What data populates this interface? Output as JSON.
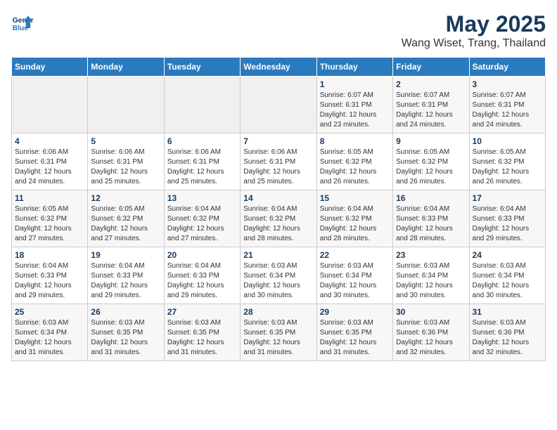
{
  "logo": {
    "line1": "General",
    "line2": "Blue"
  },
  "title": "May 2025",
  "subtitle": "Wang Wiset, Trang, Thailand",
  "days_of_week": [
    "Sunday",
    "Monday",
    "Tuesday",
    "Wednesday",
    "Thursday",
    "Friday",
    "Saturday"
  ],
  "weeks": [
    [
      {
        "day": "",
        "info": ""
      },
      {
        "day": "",
        "info": ""
      },
      {
        "day": "",
        "info": ""
      },
      {
        "day": "",
        "info": ""
      },
      {
        "day": "1",
        "info": "Sunrise: 6:07 AM\nSunset: 6:31 PM\nDaylight: 12 hours\nand 23 minutes."
      },
      {
        "day": "2",
        "info": "Sunrise: 6:07 AM\nSunset: 6:31 PM\nDaylight: 12 hours\nand 24 minutes."
      },
      {
        "day": "3",
        "info": "Sunrise: 6:07 AM\nSunset: 6:31 PM\nDaylight: 12 hours\nand 24 minutes."
      }
    ],
    [
      {
        "day": "4",
        "info": "Sunrise: 6:06 AM\nSunset: 6:31 PM\nDaylight: 12 hours\nand 24 minutes."
      },
      {
        "day": "5",
        "info": "Sunrise: 6:06 AM\nSunset: 6:31 PM\nDaylight: 12 hours\nand 25 minutes."
      },
      {
        "day": "6",
        "info": "Sunrise: 6:06 AM\nSunset: 6:31 PM\nDaylight: 12 hours\nand 25 minutes."
      },
      {
        "day": "7",
        "info": "Sunrise: 6:06 AM\nSunset: 6:31 PM\nDaylight: 12 hours\nand 25 minutes."
      },
      {
        "day": "8",
        "info": "Sunrise: 6:05 AM\nSunset: 6:32 PM\nDaylight: 12 hours\nand 26 minutes."
      },
      {
        "day": "9",
        "info": "Sunrise: 6:05 AM\nSunset: 6:32 PM\nDaylight: 12 hours\nand 26 minutes."
      },
      {
        "day": "10",
        "info": "Sunrise: 6:05 AM\nSunset: 6:32 PM\nDaylight: 12 hours\nand 26 minutes."
      }
    ],
    [
      {
        "day": "11",
        "info": "Sunrise: 6:05 AM\nSunset: 6:32 PM\nDaylight: 12 hours\nand 27 minutes."
      },
      {
        "day": "12",
        "info": "Sunrise: 6:05 AM\nSunset: 6:32 PM\nDaylight: 12 hours\nand 27 minutes."
      },
      {
        "day": "13",
        "info": "Sunrise: 6:04 AM\nSunset: 6:32 PM\nDaylight: 12 hours\nand 27 minutes."
      },
      {
        "day": "14",
        "info": "Sunrise: 6:04 AM\nSunset: 6:32 PM\nDaylight: 12 hours\nand 28 minutes."
      },
      {
        "day": "15",
        "info": "Sunrise: 6:04 AM\nSunset: 6:32 PM\nDaylight: 12 hours\nand 28 minutes."
      },
      {
        "day": "16",
        "info": "Sunrise: 6:04 AM\nSunset: 6:33 PM\nDaylight: 12 hours\nand 28 minutes."
      },
      {
        "day": "17",
        "info": "Sunrise: 6:04 AM\nSunset: 6:33 PM\nDaylight: 12 hours\nand 29 minutes."
      }
    ],
    [
      {
        "day": "18",
        "info": "Sunrise: 6:04 AM\nSunset: 6:33 PM\nDaylight: 12 hours\nand 29 minutes."
      },
      {
        "day": "19",
        "info": "Sunrise: 6:04 AM\nSunset: 6:33 PM\nDaylight: 12 hours\nand 29 minutes."
      },
      {
        "day": "20",
        "info": "Sunrise: 6:04 AM\nSunset: 6:33 PM\nDaylight: 12 hours\nand 29 minutes."
      },
      {
        "day": "21",
        "info": "Sunrise: 6:03 AM\nSunset: 6:34 PM\nDaylight: 12 hours\nand 30 minutes."
      },
      {
        "day": "22",
        "info": "Sunrise: 6:03 AM\nSunset: 6:34 PM\nDaylight: 12 hours\nand 30 minutes."
      },
      {
        "day": "23",
        "info": "Sunrise: 6:03 AM\nSunset: 6:34 PM\nDaylight: 12 hours\nand 30 minutes."
      },
      {
        "day": "24",
        "info": "Sunrise: 6:03 AM\nSunset: 6:34 PM\nDaylight: 12 hours\nand 30 minutes."
      }
    ],
    [
      {
        "day": "25",
        "info": "Sunrise: 6:03 AM\nSunset: 6:34 PM\nDaylight: 12 hours\nand 31 minutes."
      },
      {
        "day": "26",
        "info": "Sunrise: 6:03 AM\nSunset: 6:35 PM\nDaylight: 12 hours\nand 31 minutes."
      },
      {
        "day": "27",
        "info": "Sunrise: 6:03 AM\nSunset: 6:35 PM\nDaylight: 12 hours\nand 31 minutes."
      },
      {
        "day": "28",
        "info": "Sunrise: 6:03 AM\nSunset: 6:35 PM\nDaylight: 12 hours\nand 31 minutes."
      },
      {
        "day": "29",
        "info": "Sunrise: 6:03 AM\nSunset: 6:35 PM\nDaylight: 12 hours\nand 31 minutes."
      },
      {
        "day": "30",
        "info": "Sunrise: 6:03 AM\nSunset: 6:36 PM\nDaylight: 12 hours\nand 32 minutes."
      },
      {
        "day": "31",
        "info": "Sunrise: 6:03 AM\nSunset: 6:36 PM\nDaylight: 12 hours\nand 32 minutes."
      }
    ]
  ]
}
